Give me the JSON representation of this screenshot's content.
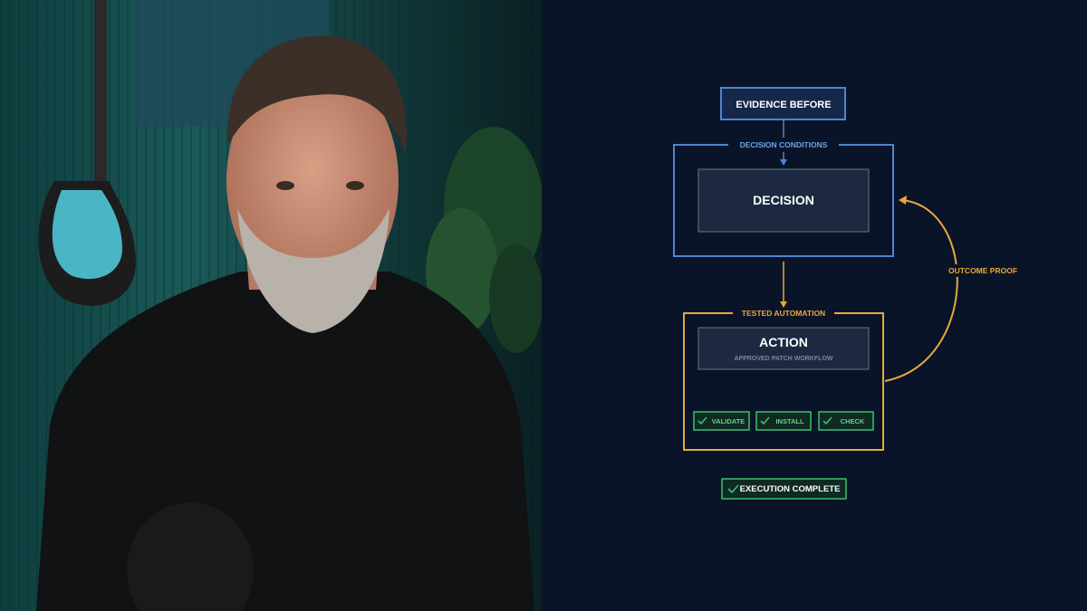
{
  "presenter": {
    "description": "Bearded presenter in black t-shirt in a studio with guitars and plants"
  },
  "diagram": {
    "evidence_label": "EVIDENCE BEFORE",
    "conditions_label": "DECISION CONDITIONS",
    "decision_label": "DECISION",
    "automation_label": "TESTED AUTOMATION",
    "action_label": "ACTION",
    "action_sub": "APPROVED PATCH WORKFLOW",
    "steps": [
      "VALIDATE",
      "INSTALL",
      "CHECK"
    ],
    "loop_label": "OUTCOME PROOF",
    "complete_label": "EXECUTION COMPLETE"
  },
  "colors": {
    "background": "#091428",
    "blue": "#4c86cf",
    "gold": "#e8a93c",
    "green": "#3fbf6f",
    "box_fill": "#1c2940"
  }
}
